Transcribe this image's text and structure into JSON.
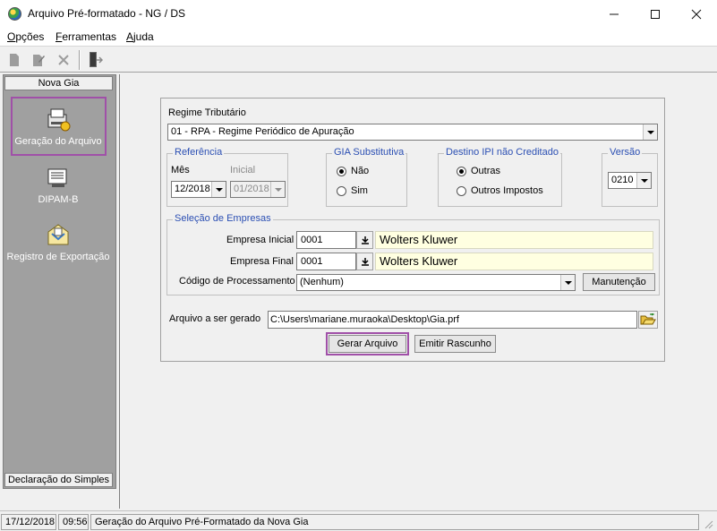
{
  "window": {
    "title": "Arquivo Pré-formatado - NG / DS",
    "controls": {
      "minimize": "—",
      "maximize": "☐",
      "close": "✕"
    }
  },
  "menu": {
    "items": [
      {
        "label": "Opções",
        "accel": "O"
      },
      {
        "label": "Ferramentas",
        "accel": "F"
      },
      {
        "label": "Ajuda",
        "accel": "A"
      }
    ]
  },
  "toolbar": {
    "icons": [
      "new-document-icon",
      "edit-icon",
      "delete-icon",
      "exit-door-icon"
    ]
  },
  "sidebar": {
    "top_header": "Nova Gia",
    "items": [
      {
        "label": "Geração do Arquivo",
        "icon": "file-generation-icon",
        "selected": true
      },
      {
        "label": "DIPAM-B",
        "icon": "dipam-icon"
      },
      {
        "label": "Registro de Exportação",
        "icon": "export-registry-icon"
      }
    ],
    "bottom_header": "Declaração do Simples"
  },
  "form": {
    "regime_label": "Regime Tributário",
    "regime_value": "01 - RPA - Regime Periódico de Apuração",
    "referencia": {
      "title": "Referência",
      "mes_label": "Mês",
      "mes_value": "12/2018",
      "inicial_label": "Inicial",
      "inicial_value": "01/2018"
    },
    "gia_substitutiva": {
      "title": "GIA Substitutiva",
      "options": [
        "Não",
        "Sim"
      ],
      "selected": "Não"
    },
    "destino_ipi": {
      "title": "Destino IPI não Creditado",
      "options": [
        "Outras",
        "Outros Impostos"
      ],
      "selected": "Outras"
    },
    "versao": {
      "title": "Versão",
      "value": "0210"
    },
    "selecao_empresas": {
      "title": "Seleção de Empresas",
      "inicial_label": "Empresa Inicial",
      "inicial_code": "0001",
      "inicial_name": "Wolters Kluwer",
      "final_label": "Empresa Final",
      "final_code": "0001",
      "final_name": "Wolters Kluwer",
      "codigo_label": "Código de Processamento",
      "codigo_value": "(Nenhum)",
      "manutencao_label": "Manutenção"
    },
    "arquivo_label": "Arquivo a ser gerado",
    "arquivo_value": "C:\\Users\\mariane.muraoka\\Desktop\\Gia.prf",
    "gerar_label": "Gerar Arquivo",
    "rascunho_label": "Emitir Rascunho"
  },
  "status": {
    "date": "17/12/2018",
    "time": "09:56",
    "message": "Geração do Arquivo Pré-Formatado da Nova Gia"
  },
  "colors": {
    "highlight": "#a050a8",
    "group_title": "#2b4fb3",
    "name_field_bg": "#ffffe1",
    "sidebar_bg": "#a0a0a0"
  }
}
